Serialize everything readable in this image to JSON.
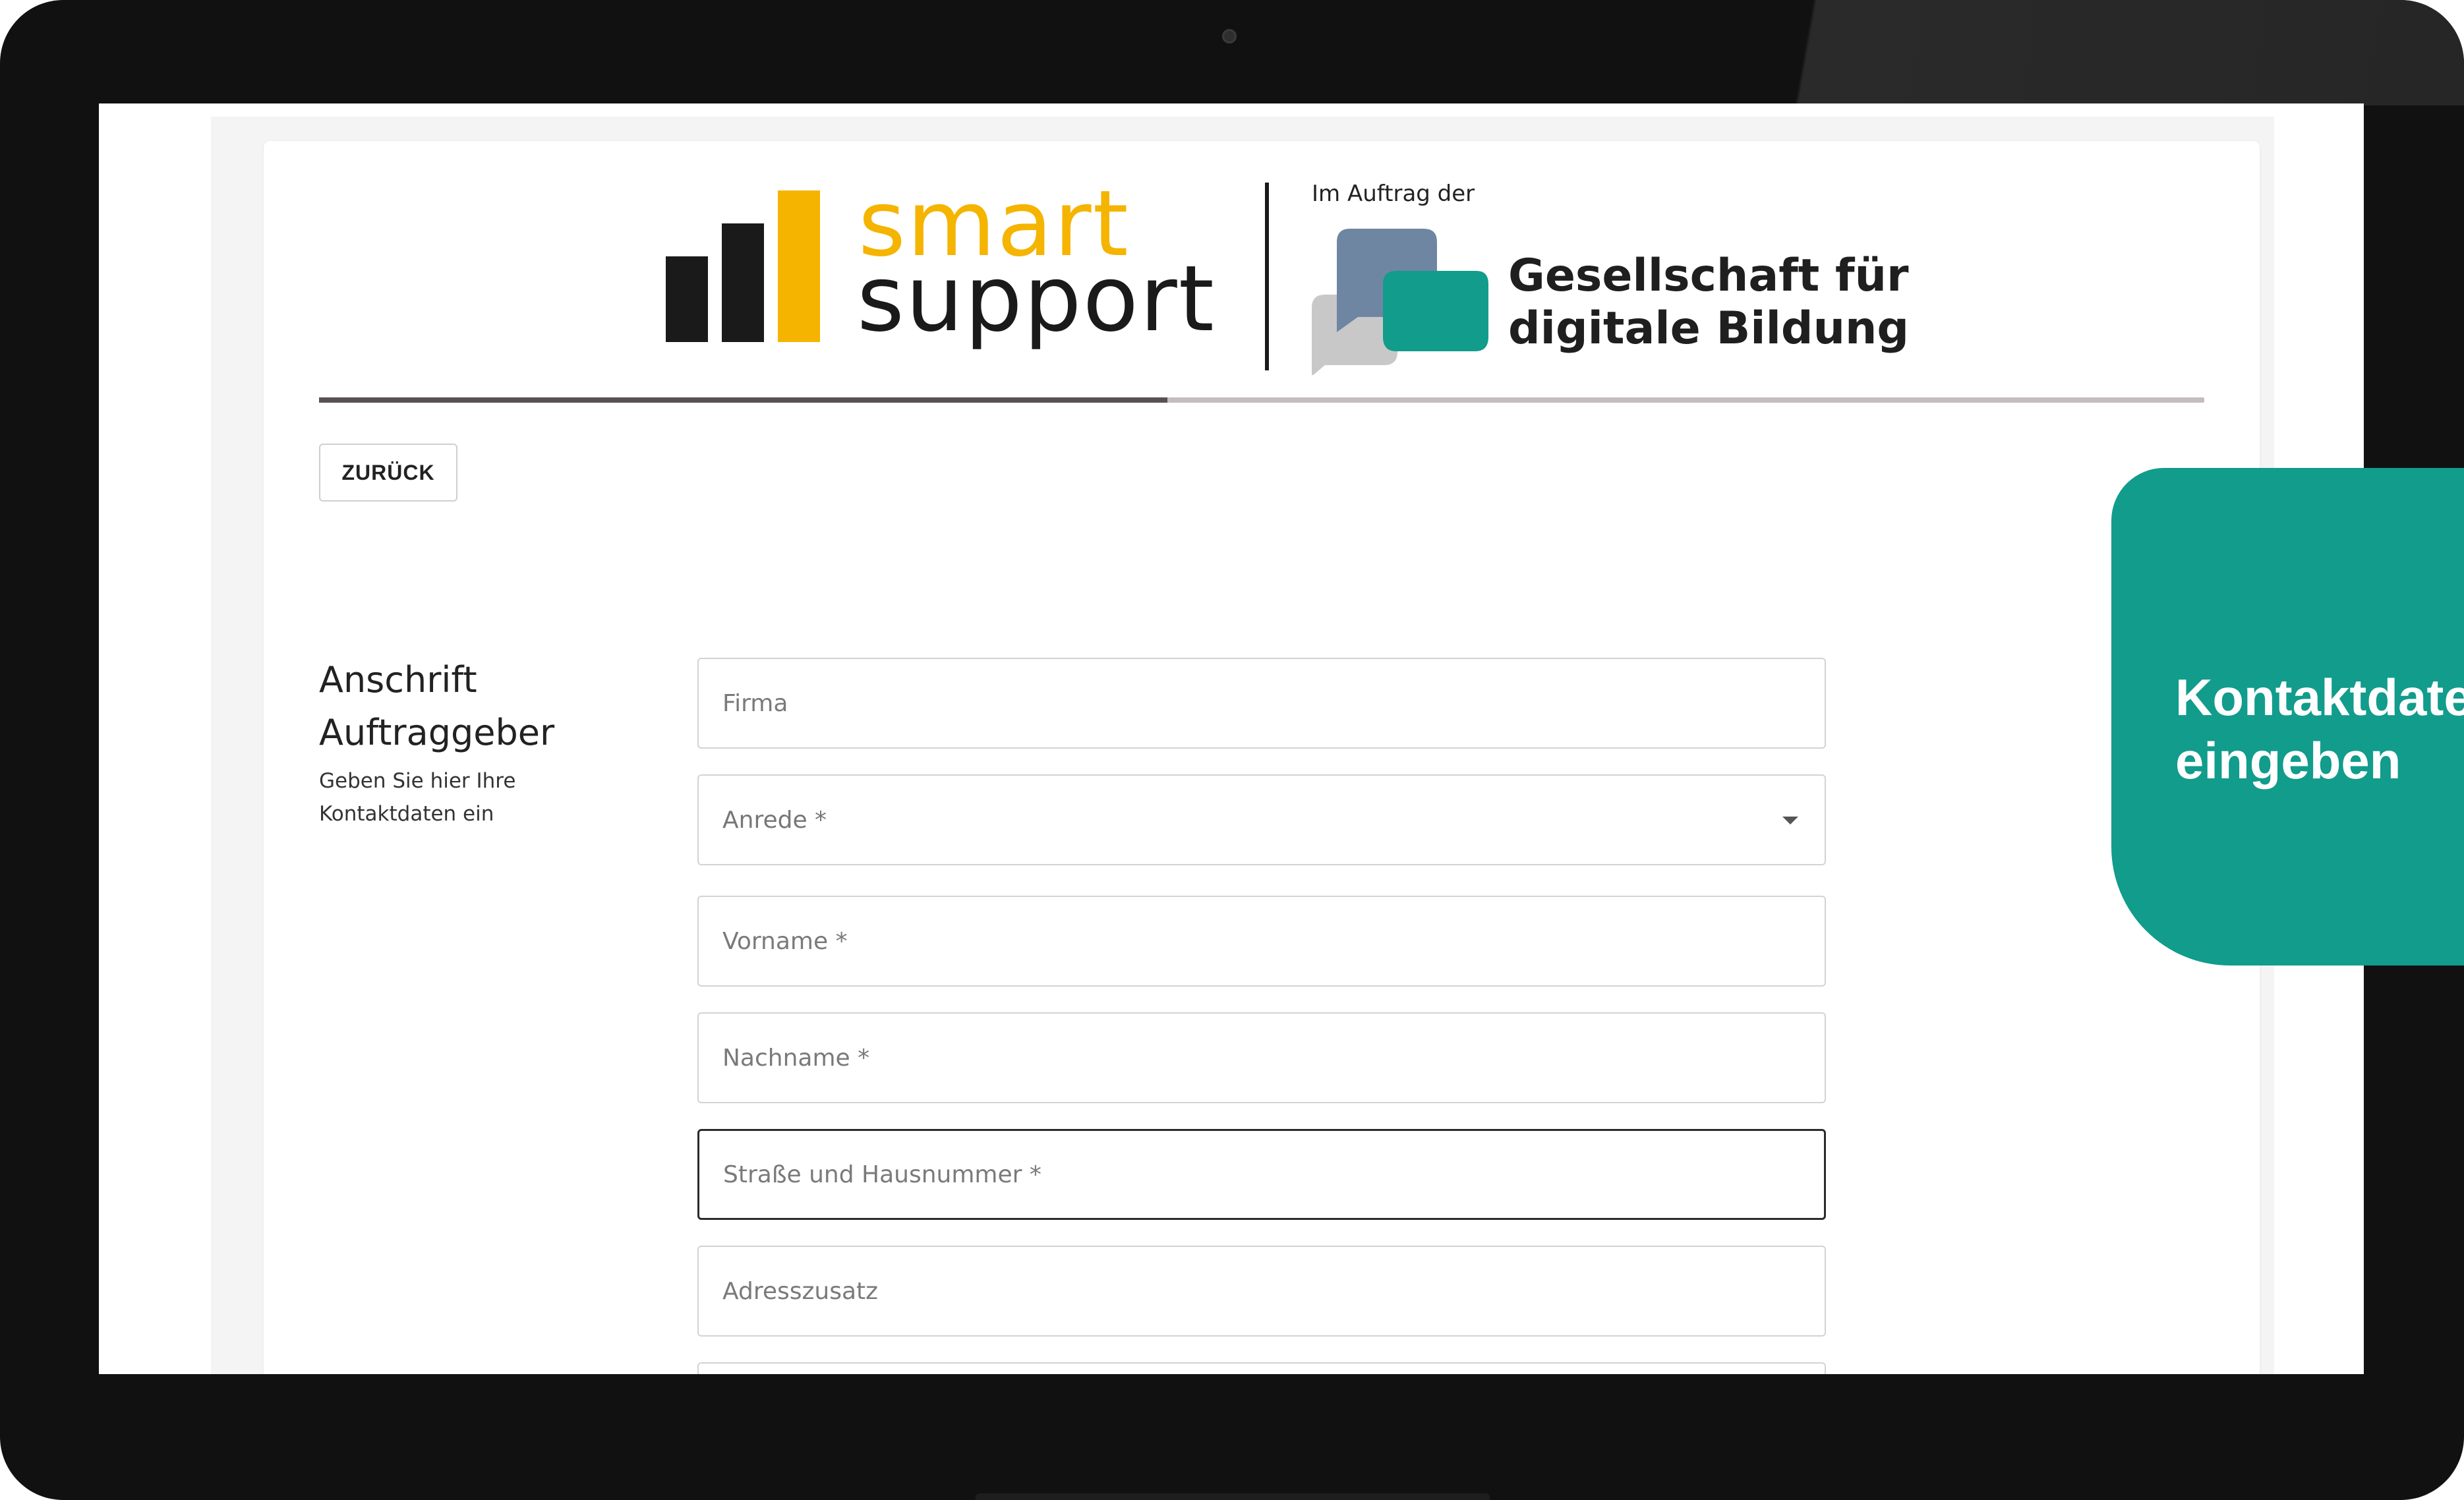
{
  "header": {
    "smart_word": "smart",
    "support_word": "support",
    "auftrag_label": "Im Auftrag der",
    "gdb_line1": "Gesellschaft für",
    "gdb_line2": "digitale Bildung"
  },
  "progress": {
    "fraction": 0.45
  },
  "back_button": {
    "label": "ZURÜCK"
  },
  "section": {
    "title_line1": "Anschrift",
    "title_line2": "Auftraggeber",
    "subtitle_line1": "Geben Sie hier Ihre",
    "subtitle_line2": "Kontaktdaten ein"
  },
  "fields": [
    {
      "placeholder": "Firma"
    },
    {
      "placeholder": "Anrede *",
      "type": "select"
    },
    {
      "placeholder": "Vorname *"
    },
    {
      "placeholder": "Nachname *"
    },
    {
      "placeholder": "Straße und Hausnummer *",
      "focused": true
    },
    {
      "placeholder": "Adresszusatz"
    },
    {
      "placeholder": ""
    }
  ],
  "callout": {
    "line1": "Kontaktdaten",
    "line2": "eingeben"
  },
  "colors": {
    "brand_yellow": "#f5b400",
    "brand_teal": "#119c8c",
    "brand_slate": "#6f86a3",
    "progress_fill": "#5a4f52",
    "progress_track": "#c5bcbe"
  },
  "icons": {
    "select_caret": "chevron-down-icon",
    "camera": "camera-icon"
  }
}
